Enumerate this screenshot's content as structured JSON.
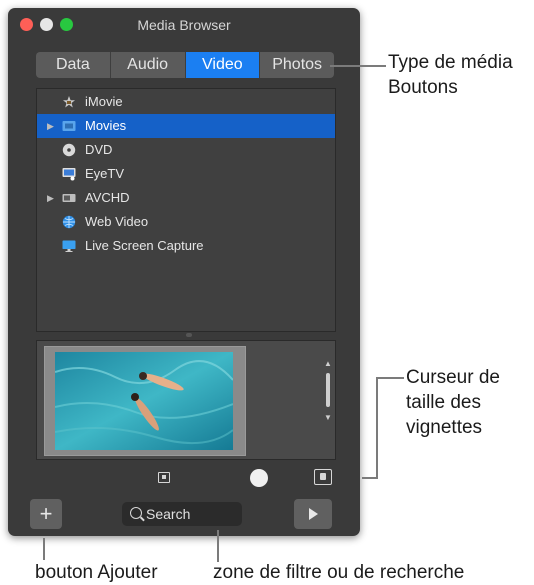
{
  "window": {
    "title": "Media Browser"
  },
  "tabs": [
    {
      "label": "Data",
      "active": false
    },
    {
      "label": "Audio",
      "active": false
    },
    {
      "label": "Video",
      "active": true
    },
    {
      "label": "Photos",
      "active": false
    }
  ],
  "sources": [
    {
      "label": "iMovie",
      "icon": "imovie-star-icon",
      "disclosure": false,
      "selected": false
    },
    {
      "label": "Movies",
      "icon": "movies-folder-icon",
      "disclosure": true,
      "selected": true
    },
    {
      "label": "DVD",
      "icon": "dvd-disc-icon",
      "disclosure": false,
      "selected": false
    },
    {
      "label": "EyeTV",
      "icon": "eyetv-icon",
      "disclosure": false,
      "selected": false
    },
    {
      "label": "AVCHD",
      "icon": "avchd-icon",
      "disclosure": true,
      "selected": false
    },
    {
      "label": "Web Video",
      "icon": "web-globe-icon",
      "disclosure": false,
      "selected": false
    },
    {
      "label": "Live Screen Capture",
      "icon": "screen-capture-icon",
      "disclosure": false,
      "selected": false
    }
  ],
  "thumbnail_size": 0.6,
  "search": {
    "placeholder": "Search"
  },
  "annotations": {
    "media_type_line1": "Type de média",
    "media_type_line2": "Boutons",
    "slider_line1": "Curseur de",
    "slider_line2": "taille des",
    "slider_line3": "vignettes",
    "add_button": "bouton Ajouter",
    "search_field": "zone de filtre ou de recherche"
  },
  "colors": {
    "accent": "#1b7ff2",
    "selection": "#1561c8",
    "window_bg": "#3a3a3a"
  }
}
